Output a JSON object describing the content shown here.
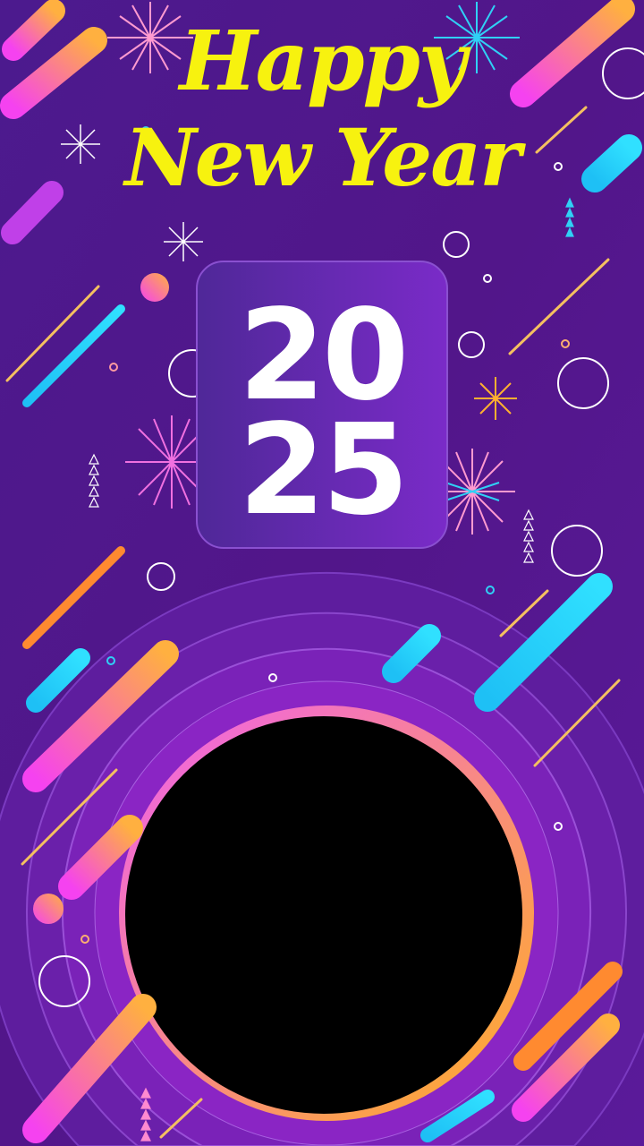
{
  "greeting": {
    "line1": "Happy",
    "line2": "New Year"
  },
  "year": {
    "top": "20",
    "bottom": "25"
  },
  "colors": {
    "background": "#4a1585",
    "title": "#f7f20f",
    "card": "#6a2bb0",
    "photo_frame": "#000000",
    "cyan": "#1ed0f5",
    "pink": "#f542f0",
    "orange": "#ffa033"
  }
}
